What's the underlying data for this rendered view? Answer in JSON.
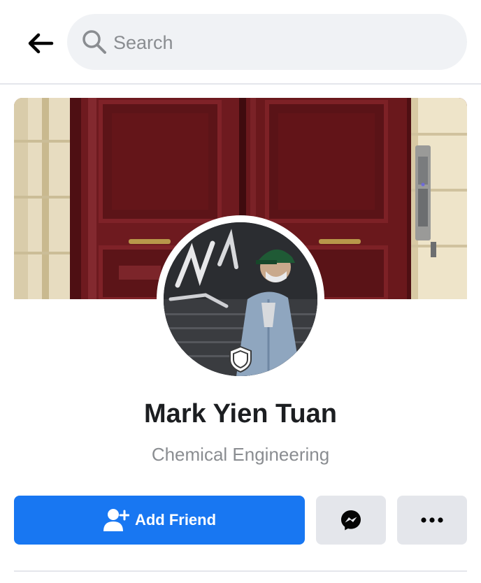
{
  "search": {
    "placeholder": "Search"
  },
  "profile": {
    "name": "Mark Yien Tuan",
    "subtitle": "Chemical Engineering"
  },
  "actions": {
    "add_friend_label": "Add Friend",
    "message_icon": "messenger-icon",
    "more_icon": "more-icon"
  },
  "icons": {
    "back": "back-arrow-icon",
    "search": "search-icon",
    "shield": "shield-icon",
    "add_friend": "add-friend-icon"
  },
  "colors": {
    "accent": "#1877f2",
    "search_bg": "#f0f2f5",
    "button_gray": "#e4e6eb",
    "name_text": "#1c1e21",
    "subtitle_text": "#8a8d91"
  }
}
